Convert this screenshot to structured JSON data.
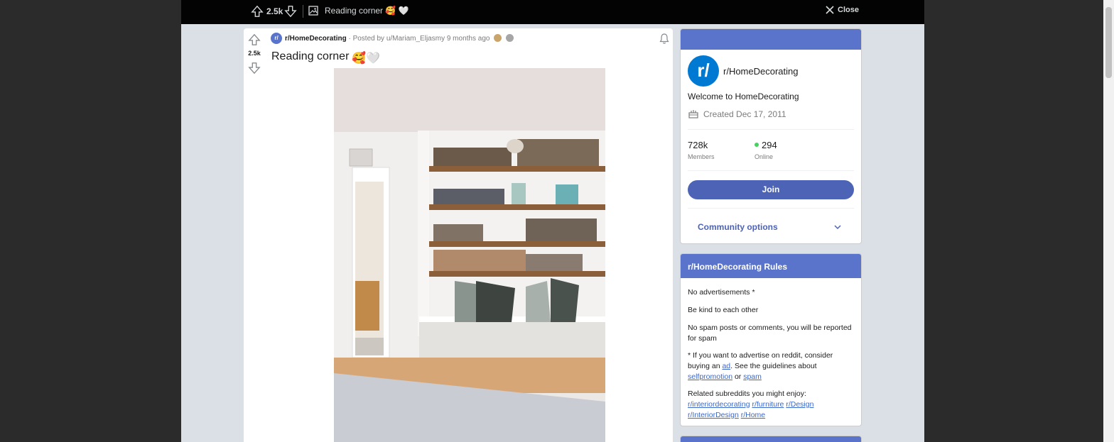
{
  "topbar": {
    "score": "2.5k",
    "title": "Reading corner 🥰 🤍",
    "close_label": "Close"
  },
  "post": {
    "score": "2.5k",
    "subreddit": "r/HomeDecorating",
    "posted_by": " · Posted by u/Mariam_Eljasmy 9 months ago",
    "title": "Reading corner",
    "title_emoji": "🥰🤍"
  },
  "about": {
    "avatar_text": "r/",
    "name": "r/HomeDecorating",
    "welcome": "Welcome to HomeDecorating",
    "created": "Created Dec 17, 2011",
    "members_count": "728k",
    "members_label": "Members",
    "online_count": "294",
    "online_label": "Online",
    "join_label": "Join",
    "community_options_label": "Community options"
  },
  "rules": {
    "title": "r/HomeDecorating Rules",
    "rule1": "No advertisements *",
    "rule2": "Be kind to each other",
    "rule3": "No spam posts or comments, you will be reported for spam",
    "rule4_part1": "* If you want to advertise on reddit, consider buying an ",
    "rule4_link_ad": "ad",
    "rule4_part2": ". See the guidelines about ",
    "rule4_link_selfpromotion": "selfpromotion",
    "rule4_or": " or ",
    "rule4_link_spam": "spam",
    "related_intro": "Related subreddits you might enjoy:",
    "related": [
      "r/interiordecorating",
      "r/furniture",
      "r/Design",
      "r/InteriorDesign",
      "r/Home"
    ]
  },
  "colors": {
    "accent": "#5a74cc",
    "join": "#4c63b6",
    "topbar": "#030303",
    "online": "#46d160"
  }
}
